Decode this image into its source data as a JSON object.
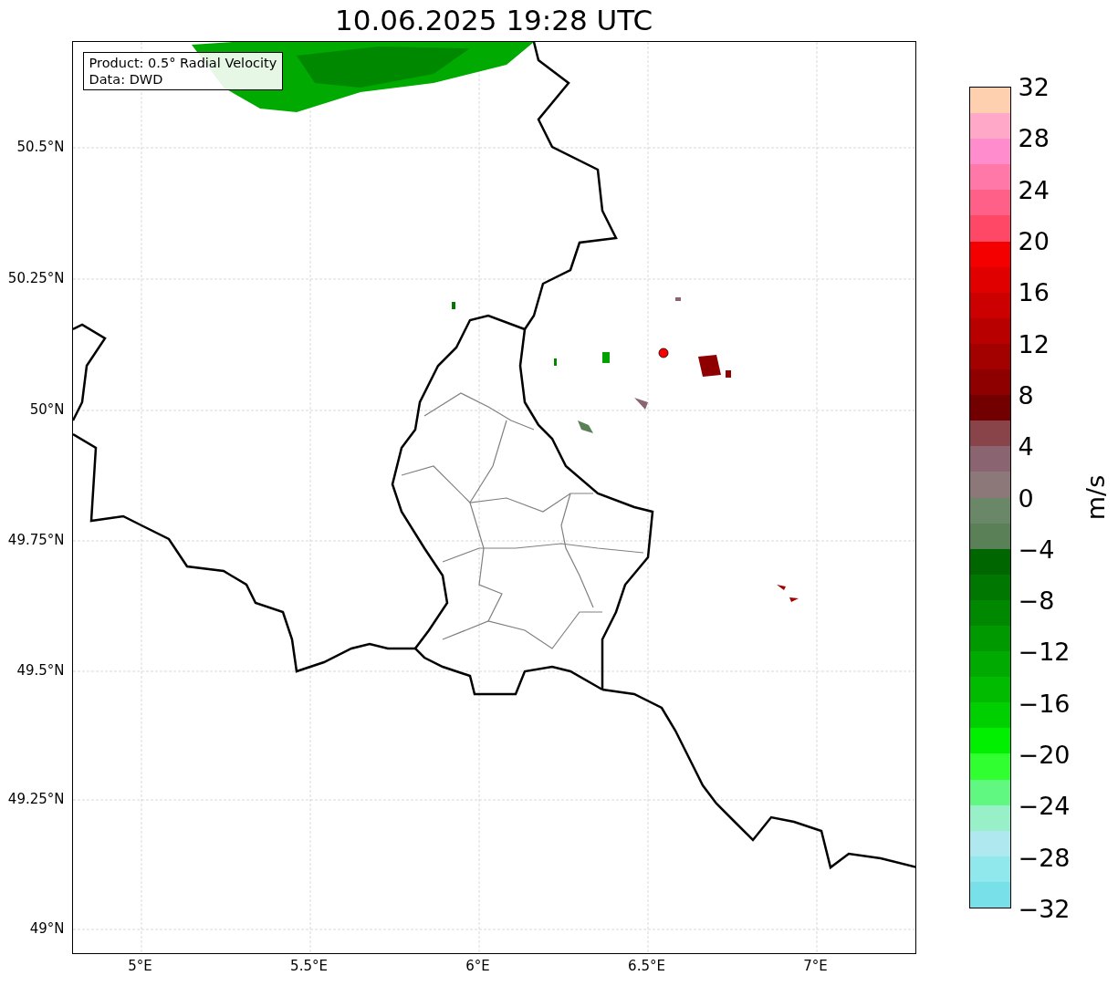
{
  "title": "10.06.2025 19:28 UTC",
  "info_box": {
    "lines": [
      "Product: 0.5° Radial Velocity",
      "Data: DWD"
    ]
  },
  "map": {
    "y_ticks": [
      "50.5°N",
      "50.25°N",
      "50°N",
      "49.75°N",
      "49.5°N",
      "49.25°N",
      "49°N"
    ],
    "x_ticks": [
      "5°E",
      "5.5°E",
      "6°E",
      "6.5°E",
      "7°E"
    ]
  },
  "colorbar": {
    "label": "m/s",
    "ticks": [
      "32",
      "28",
      "24",
      "20",
      "16",
      "12",
      "8",
      "4",
      "0",
      "−4",
      "−8",
      "−12",
      "−16",
      "−20",
      "−24",
      "−28",
      "−32"
    ],
    "segments": [
      {
        "color": "#ffd0b0"
      },
      {
        "color": "#ffa8c8"
      },
      {
        "color": "#ff8ccc"
      },
      {
        "color": "#ff78a8"
      },
      {
        "color": "#ff6088"
      },
      {
        "color": "#ff4866"
      },
      {
        "color": "#f50000"
      },
      {
        "color": "#e00000"
      },
      {
        "color": "#cc0000"
      },
      {
        "color": "#b80000"
      },
      {
        "color": "#a30000"
      },
      {
        "color": "#8e0000"
      },
      {
        "color": "#720000"
      },
      {
        "color": "#884448"
      },
      {
        "color": "#8a6470"
      },
      {
        "color": "#8c7878"
      },
      {
        "color": "#6a8868"
      },
      {
        "color": "#5a8058"
      },
      {
        "color": "#006600"
      },
      {
        "color": "#007700"
      },
      {
        "color": "#008800"
      },
      {
        "color": "#009900"
      },
      {
        "color": "#00aa00"
      },
      {
        "color": "#00bb00"
      },
      {
        "color": "#00d000"
      },
      {
        "color": "#00f000"
      },
      {
        "color": "#30ff30"
      },
      {
        "color": "#60f880"
      },
      {
        "color": "#98f0c8"
      },
      {
        "color": "#b0e8f0"
      },
      {
        "color": "#90e8ec"
      },
      {
        "color": "#78e0e8"
      }
    ]
  }
}
